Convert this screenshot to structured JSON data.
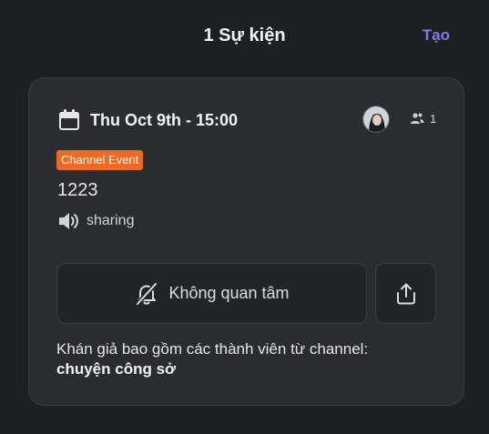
{
  "header": {
    "title": "1 Sự kiện",
    "create_label": "Tạo"
  },
  "event": {
    "date": "Thu Oct 9th - 15:00",
    "attendee_count": "1",
    "badge": "Channel Event",
    "name": "1223",
    "location": "sharing",
    "interest_label": "Không quan tâm",
    "audience_text": "Khán giả bao gồm các thành viên từ channel:",
    "channel_name": "chuyện công sở"
  },
  "icons": {
    "calendar": "calendar-icon",
    "attendees": "people-icon",
    "location": "speaker-icon",
    "interest": "bell-off-icon",
    "share": "share-icon"
  },
  "colors": {
    "background": "#1e1f22",
    "card": "#2b2c30",
    "accent": "#7b7ff0",
    "badge": "#ec6a24"
  }
}
